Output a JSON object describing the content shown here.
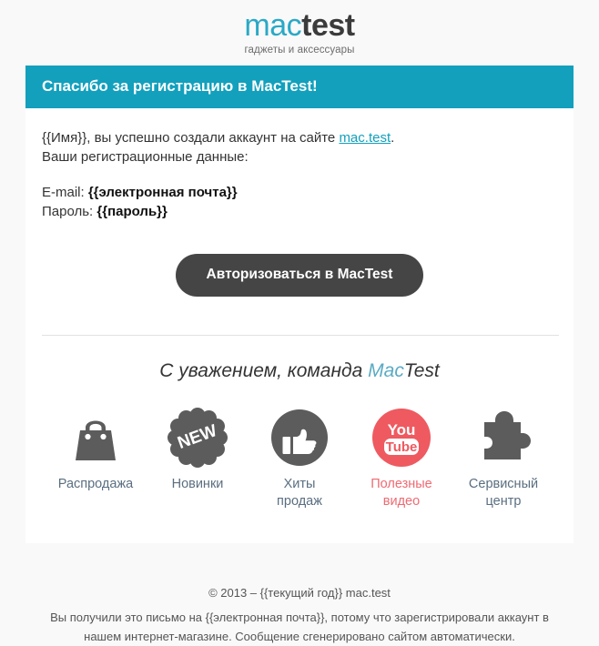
{
  "logo": {
    "part1": "mac",
    "part2": "test",
    "tagline": "гаджеты и аксессуары"
  },
  "banner": {
    "title": "Спасибо за регистрацию в MacTest!",
    "bg_color": "#12a0bd"
  },
  "message": {
    "line1_before": "{{Имя}}, вы успешно создали аккаунт на сайте ",
    "link_text": "mac.test",
    "line1_after": ".",
    "line2": "Ваши регистрационные данные:",
    "email_label": "E-mail: ",
    "email_value": "{{электронная почта}}",
    "password_label": "Пароль: ",
    "password_value": "{{пароль}}"
  },
  "cta": {
    "label": "Авторизоваться в MacTest",
    "bg_color": "#454545"
  },
  "signoff": {
    "text": "С уважением, команда ",
    "brand_part1": "Mac",
    "brand_part2": "Test"
  },
  "icons": [
    {
      "name": "shopping-bag-icon",
      "label": "Распродажа",
      "color": "#5c5c5c",
      "label_color": "#5a6e80"
    },
    {
      "name": "new-badge-icon",
      "label": "Новинки",
      "color": "#5c5c5c",
      "label_color": "#5a6e80"
    },
    {
      "name": "thumbs-up-icon",
      "label": "Хиты\nпродаж",
      "label_line1": "Хиты",
      "label_line2": "продаж",
      "color": "#5c5c5c",
      "label_color": "#5a6e80"
    },
    {
      "name": "youtube-icon",
      "label_line1": "Полезные",
      "label_line2": "видео",
      "color": "#ee5a60",
      "label_color": "#ef6a72"
    },
    {
      "name": "puzzle-piece-icon",
      "label_line1": "Сервисный",
      "label_line2": "центр",
      "color": "#5c5c5c",
      "label_color": "#5a6e80"
    }
  ],
  "icon_text": {
    "new_badge_text": "NEW",
    "youtube_you": "You",
    "youtube_tube": "Tube"
  },
  "footer": {
    "copyright": "© 2013 – {{текущий год}} mac.test",
    "note": "Вы получили это письмо на {{электронная почта}}, потому что зарегистрировали аккаунт в нашем интернет-магазине. Сообщение сгенерировано сайтом автоматически."
  }
}
